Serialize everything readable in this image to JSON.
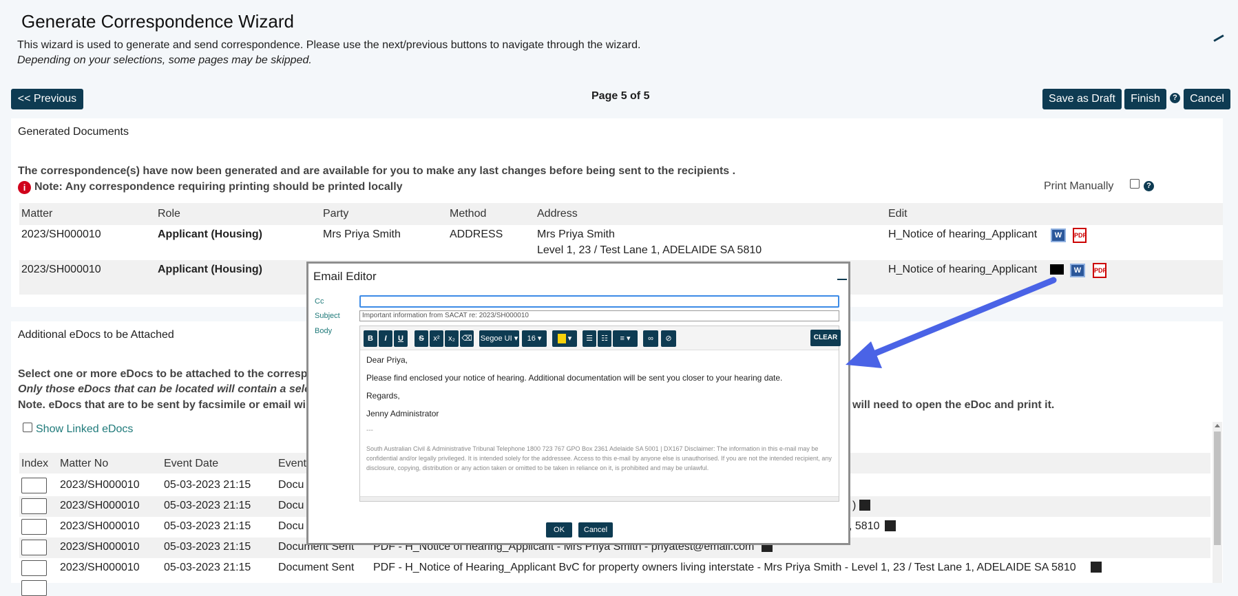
{
  "wizard": {
    "title": "Generate Correspondence Wizard",
    "intro": "This wizard is used to generate and send correspondence. Please use the next/previous buttons to navigate through the wizard.",
    "intro_italic": "Depending on your selections, some pages may be skipped.",
    "page_indicator": "Page 5 of 5"
  },
  "nav": {
    "previous": "<< Previous",
    "save_draft": "Save as Draft",
    "finish": "Finish",
    "cancel": "Cancel",
    "help": "?"
  },
  "generated": {
    "heading": "Generated Documents",
    "message": "The correspondence(s) have now been generated and are available for you to make any last changes before being sent to the recipients .",
    "note": "Note: Any correspondence requiring printing should be printed locally",
    "print_manually": "Print Manually",
    "columns": [
      "Matter",
      "Role",
      "Party",
      "Method",
      "Address",
      "Edit"
    ],
    "rows": [
      {
        "matter": "2023/SH000010",
        "role": "Applicant (Housing)",
        "party": "Mrs Priya Smith",
        "method": "ADDRESS",
        "address_1": "Mrs Priya Smith",
        "address_2": "Level 1, 23 / Test Lane 1, ADELAIDE SA 5810",
        "edit": "H_Notice of hearing_Applicant"
      },
      {
        "matter": "2023/SH000010",
        "role": "Applicant (Housing)",
        "party": "",
        "method": "",
        "address_1": "",
        "address_2": "",
        "edit": "H_Notice of hearing_Applicant"
      }
    ]
  },
  "edocs": {
    "heading": "Additional eDocs to be Attached",
    "line1": "Select one or more eDocs to be attached to the correspo",
    "line2": "Only those eDocs that can be located will contain a sele",
    "line3": "Note. eDocs that are to be sent by facsimile or email wil",
    "line3_tail": "will need to open the eDoc and print it.",
    "show_linked": "Show Linked eDocs",
    "columns": [
      "Index",
      "Matter No",
      "Event Date",
      "Event"
    ],
    "rows": [
      {
        "matter": "2023/SH000010",
        "date": "05-03-2023 21:15",
        "event": "Docu",
        "desc": ""
      },
      {
        "matter": "2023/SH000010",
        "date": "05-03-2023 21:15",
        "event": "Docu",
        "desc": ")"
      },
      {
        "matter": "2023/SH000010",
        "date": "05-03-2023 21:15",
        "event": "Docu",
        "desc": ", 5810"
      },
      {
        "matter": "2023/SH000010",
        "date": "05-03-2023 21:15",
        "event": "Document Sent",
        "desc": "PDF - H_Notice of hearing_Applicant - Mrs Priya Smith - priyatest@email.com"
      },
      {
        "matter": "2023/SH000010",
        "date": "05-03-2023 21:15",
        "event": "Document Sent",
        "desc": "PDF - H_Notice of Hearing_Applicant BvC for property owners living interstate - Mrs Priya Smith - Level 1, 23 / Test Lane 1, ADELAIDE SA 5810"
      }
    ]
  },
  "email_editor": {
    "title": "Email Editor",
    "cc_label": "Cc",
    "cc_value": "",
    "subject_label": "Subject",
    "subject_value": "Important information from SACAT re: 2023/SH000010",
    "body_label": "Body",
    "toolbar": {
      "bold": "B",
      "italic": "I",
      "underline": "U",
      "strike": "S",
      "sup": "x²",
      "sub": "x₂",
      "font": "Segoe UI",
      "size": "16",
      "clear": "CLEAR"
    },
    "body": {
      "greeting": "Dear Priya,",
      "para": "Please find enclosed your notice of hearing. Additional documentation will be sent you closer to your hearing date.",
      "regards": "Regards,",
      "signature": "Jenny Administrator",
      "separator": "---",
      "disclaimer": "South Australian Civil & Administrative Tribunal Telephone 1800 723 767 GPO Box 2361 Adelaide SA 5001 | DX167 Disclaimer: The information in this e-mail may be confidential and/or legally privileged. It is intended solely for the addressee. Access to this e-mail by anyone else is unauthorised. If you are not the intended recipient, any disclosure, copying, distribution or any action taken or omitted to be taken in reliance on it, is prohibited and may be unlawful."
    },
    "ok": "OK",
    "cancel": "Cancel"
  },
  "icons": {
    "info": "i",
    "word": "W",
    "pdf": "PDF"
  },
  "colors": {
    "primary": "#0e3b52",
    "arrow": "#4a63e6",
    "link": "#1f7a7a"
  }
}
